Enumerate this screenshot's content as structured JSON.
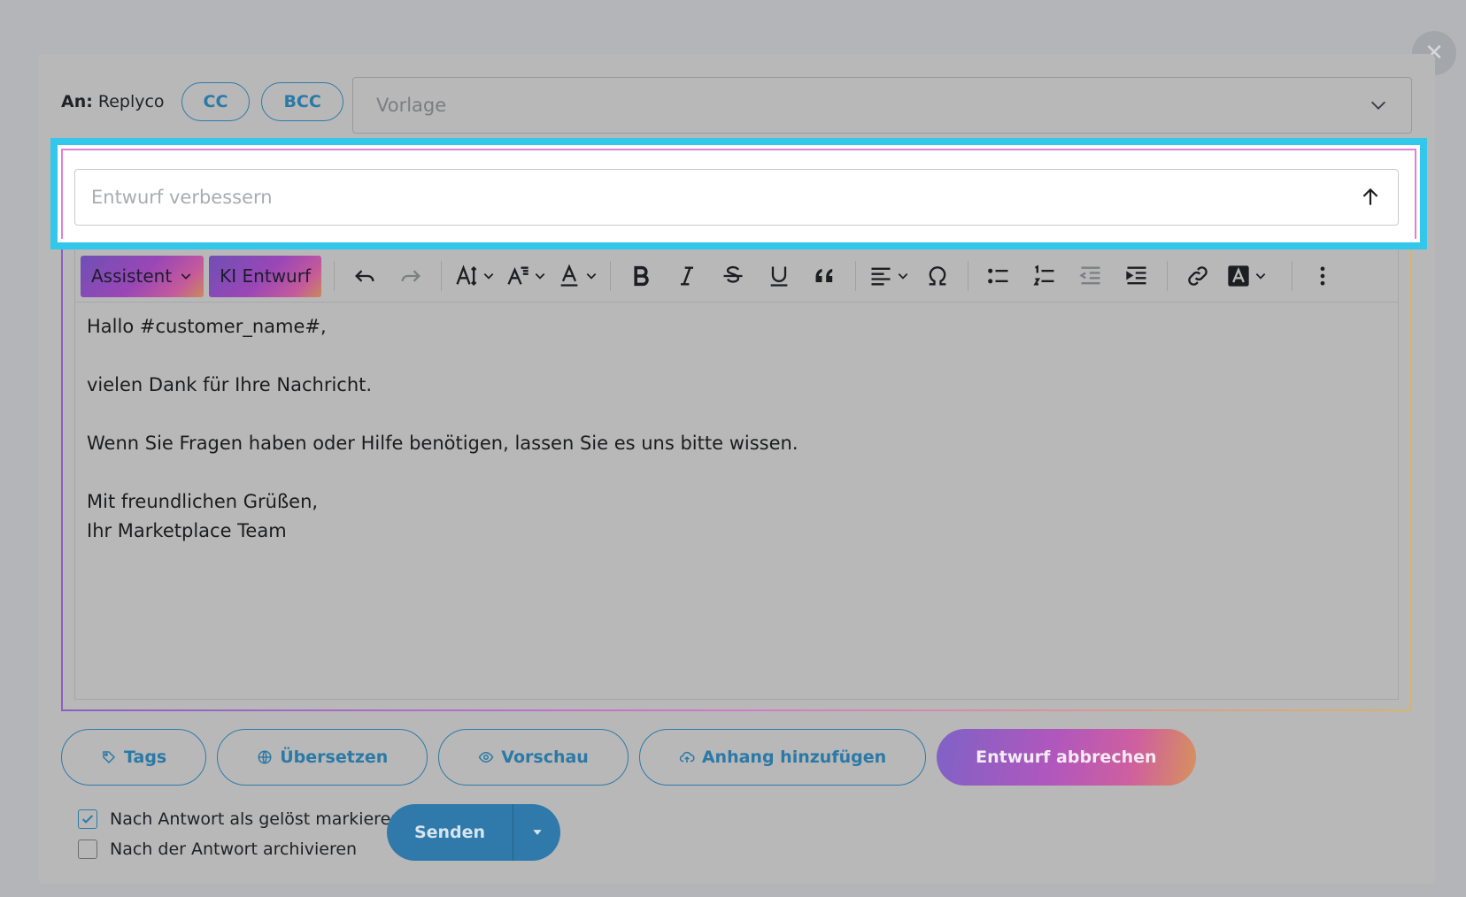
{
  "header": {
    "to_label": "An:",
    "to_value": "Replyco",
    "cc_label": "CC",
    "bcc_label": "BCC",
    "template_placeholder": "Vorlage"
  },
  "improve": {
    "placeholder": "Entwurf verbessern"
  },
  "toolbar": {
    "assistant_label": "Assistent",
    "ai_draft_label": "KI Entwurf"
  },
  "editor": {
    "lines": [
      "Hallo #customer_name#,",
      "",
      "vielen Dank für Ihre Nachricht.",
      "",
      "Wenn Sie Fragen haben oder Hilfe benötigen, lassen Sie es uns bitte wissen.",
      "",
      "Mit freundlichen Grüßen,",
      "Ihr Marketplace Team"
    ]
  },
  "actions": {
    "tags": "Tags",
    "translate": "Übersetzen",
    "preview": "Vorschau",
    "attach": "Anhang hinzufügen",
    "cancel_draft": "Entwurf abbrechen"
  },
  "options": {
    "mark_resolved": "Nach Antwort als gelöst markieren",
    "mark_resolved_checked": true,
    "archive": "Nach der Antwort archivieren",
    "archive_checked": false
  },
  "send": {
    "label": "Senden"
  },
  "colors": {
    "accent": "#2f7aab",
    "highlight": "#33c7ec"
  }
}
